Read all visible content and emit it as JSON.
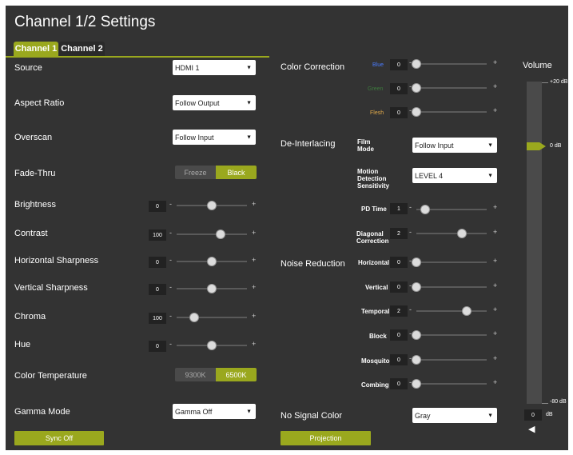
{
  "page_title": "Channel 1/2 Settings",
  "tabs": [
    {
      "label": "Channel 1",
      "active": true
    },
    {
      "label": "Channel 2",
      "active": false
    }
  ],
  "colors": {
    "accent": "#9aa81e",
    "panel": "#333333",
    "blue_label": "#4a7cff",
    "green_label": "#3d7a3d",
    "flesh_label": "#e0a94a"
  },
  "left": {
    "source": {
      "label": "Source",
      "value": "HDMI 1"
    },
    "aspect_ratio": {
      "label": "Aspect Ratio",
      "value": "Follow Output"
    },
    "overscan": {
      "label": "Overscan",
      "value": "Follow Input"
    },
    "fade_thru": {
      "label": "Fade-Thru",
      "options": [
        "Freeze",
        "Black"
      ],
      "selected": "Black"
    },
    "brightness": {
      "label": "Brightness",
      "value": "0",
      "level": 0.5
    },
    "contrast": {
      "label": "Contrast",
      "value": "100",
      "level": 0.62
    },
    "h_sharpness": {
      "label": "Horizontal Sharpness",
      "value": "0",
      "level": 0.5
    },
    "v_sharpness": {
      "label": "Vertical Sharpness",
      "value": "0",
      "level": 0.5
    },
    "chroma": {
      "label": "Chroma",
      "value": "100",
      "level": 0.25
    },
    "hue": {
      "label": "Hue",
      "value": "0",
      "level": 0.5
    },
    "color_temperature": {
      "label": "Color Temperature",
      "options": [
        "9300K",
        "6500K"
      ],
      "selected": "6500K"
    },
    "gamma_mode": {
      "label": "Gamma Mode",
      "value": "Gamma Off"
    },
    "sync_off": {
      "label": "Sync Off"
    }
  },
  "middle": {
    "color_correction": {
      "label": "Color Correction",
      "blue": {
        "label": "Blue",
        "value": "0",
        "level": 0
      },
      "green": {
        "label": "Green",
        "value": "0",
        "level": 0
      },
      "flesh": {
        "label": "Flesh",
        "value": "0",
        "level": 0
      }
    },
    "deinterlacing": {
      "label": "De-Interlacing",
      "film_mode": {
        "label_1": "Film",
        "label_2": "Mode",
        "value": "Follow Input"
      },
      "motion": {
        "label_1": "Motion",
        "label_2": "Detection",
        "label_3": "Sensitivity",
        "value": "LEVEL 4"
      },
      "pd_time": {
        "label": "PD Time",
        "value": "1",
        "level": 0.12
      },
      "diagonal": {
        "label_1": "Diagonal",
        "label_2": "Correction",
        "value": "2",
        "level": 0.65
      }
    },
    "noise_reduction": {
      "label": "Noise Reduction",
      "horizontal": {
        "label": "Horizontal",
        "value": "0",
        "level": 0
      },
      "vertical": {
        "label": "Vertical",
        "value": "0",
        "level": 0
      },
      "temporal": {
        "label": "Temporal",
        "value": "2",
        "level": 0.72
      },
      "block": {
        "label": "Block",
        "value": "0",
        "level": 0
      },
      "mosquito": {
        "label": "Mosquito",
        "value": "0",
        "level": 0
      },
      "combing": {
        "label": "Combing",
        "value": "0",
        "level": 0
      }
    },
    "no_signal_color": {
      "label": "No Signal Color",
      "value": "Gray"
    },
    "projection": {
      "label": "Projection"
    }
  },
  "volume": {
    "label": "Volume",
    "max_label": "+20 dB",
    "mid_label": "0 dB",
    "min_label": "-80 dB",
    "value": "0",
    "unit": "dB",
    "level": 0.8,
    "speaker_icon": "speaker-icon"
  },
  "glyphs": {
    "minus": "-",
    "plus": "+",
    "arrow": "▼",
    "speaker": "◀"
  }
}
